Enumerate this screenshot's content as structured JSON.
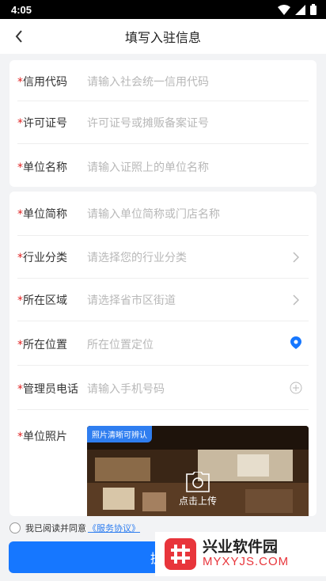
{
  "status_bar": {
    "time": "4:05"
  },
  "nav": {
    "title": "填写入驻信息"
  },
  "required_mark": "*",
  "card1": {
    "rows": [
      {
        "label": "信用代码",
        "placeholder": "请输入社会统一信用代码"
      },
      {
        "label": "许可证号",
        "placeholder": "许可证号或摊贩备案证号"
      },
      {
        "label": "单位名称",
        "placeholder": "请输入证照上的单位名称"
      }
    ]
  },
  "card2": {
    "rows": [
      {
        "label": "单位简称",
        "placeholder": "请输入单位简称或门店名称"
      },
      {
        "label": "行业分类",
        "placeholder": "请选择您的行业分类",
        "icon": "chevron-right-icon"
      },
      {
        "label": "所在区域",
        "placeholder": "请选择省市区街道",
        "icon": "chevron-right-icon"
      },
      {
        "label": "所在位置",
        "placeholder": "所在位置定位",
        "icon": "location-pin-icon"
      },
      {
        "label": "管理员电话",
        "placeholder": "请输入手机号码",
        "icon": "plus-circle-icon"
      },
      {
        "label": "单位照片"
      }
    ],
    "photo": {
      "tag": "照片清晰可辨认",
      "upload_label": "点击上传"
    }
  },
  "agreement": {
    "text": "我已阅读并同意",
    "link": "《服务协议》"
  },
  "submit": {
    "label": "提交"
  },
  "watermark": {
    "name": "兴业软件园",
    "domain": "MYXYJS.COM"
  },
  "colors": {
    "primary": "#1677ff",
    "required": "#e02020",
    "placeholder": "#b8b8b8"
  }
}
